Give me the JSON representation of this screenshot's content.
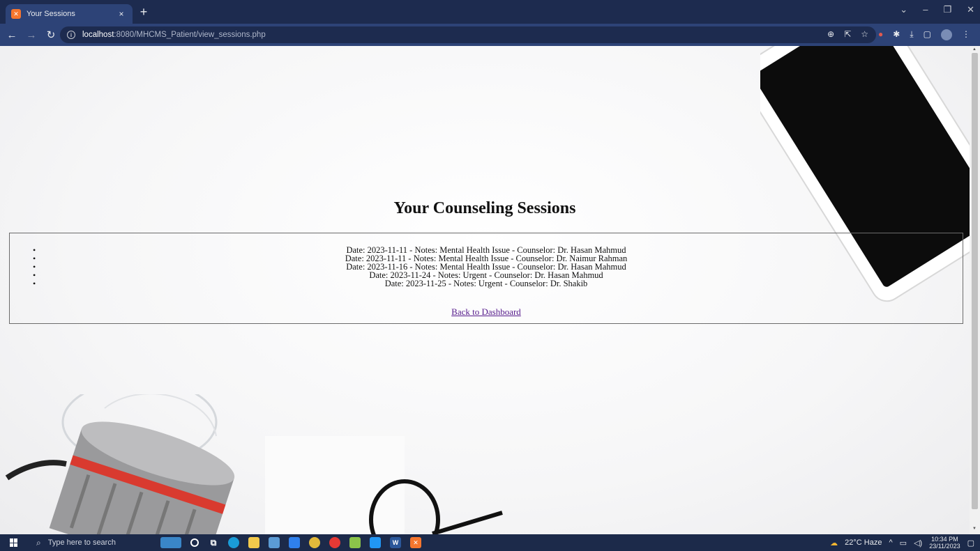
{
  "browser": {
    "tab_title": "Your Sessions",
    "tab_close": "×",
    "new_tab": "+",
    "url_host": "localhost",
    "url_path": ":8080/MHCMS_Patient/view_sessions.php",
    "window_controls": {
      "minimize": "–",
      "maximize": "❐",
      "close": "✕",
      "tabs_dropdown": "⌄"
    }
  },
  "page": {
    "title": "Your Counseling Sessions",
    "sessions": [
      "Date: 2023-11-11 - Notes: Mental Health Issue - Counselor: Dr. Hasan Mahmud",
      "Date: 2023-11-11 - Notes: Mental Health Issue - Counselor: Dr. Naimur Rahman",
      "Date: 2023-11-16 - Notes: Mental Health Issue - Counselor: Dr. Hasan Mahmud",
      "Date: 2023-11-24 - Notes: Urgent - Counselor: Dr. Hasan Mahmud",
      "Date: 2023-11-25 - Notes: Urgent - Counselor: Dr. Shakib"
    ],
    "back_link": "Back to Dashboard"
  },
  "taskbar": {
    "search_placeholder": "Type here to search",
    "weather": "22°C  Haze",
    "time": "10:34 PM",
    "date": "23/11/2023"
  },
  "colors": {
    "tabbar_bg": "#1d2b4f",
    "toolbar_bg": "#2d4377",
    "taskbar_bg": "#1c2a4a",
    "visited_link": "#551a8b"
  },
  "icons": [
    "back-arrow-icon",
    "forward-arrow-icon",
    "reload-icon",
    "info-icon",
    "zoom-icon",
    "share-icon",
    "star-icon",
    "extensions-icon",
    "download-icon",
    "sidepanel-icon",
    "profile-icon",
    "menu-icon"
  ]
}
